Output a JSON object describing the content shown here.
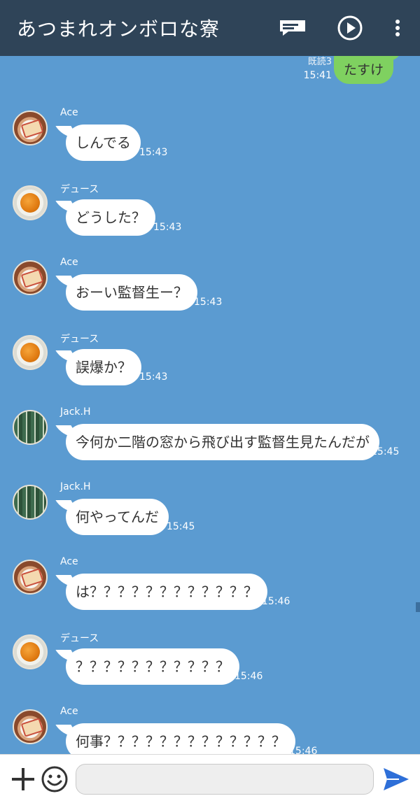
{
  "header": {
    "title": "あつまれオンボロな寮",
    "icons": [
      "notes-icon",
      "play-icon",
      "more-vertical-icon"
    ]
  },
  "sent_message": {
    "text": "たすけ",
    "read_label": "既読3",
    "time": "15:41"
  },
  "messages": [
    {
      "sender": "Ace",
      "avatar": "ace",
      "text": "しんでる",
      "time": "15:43"
    },
    {
      "sender": "デュース",
      "avatar": "deuce",
      "text": "どうした？",
      "time": "15:43"
    },
    {
      "sender": "Ace",
      "avatar": "ace",
      "text": "おーい監督生ー？",
      "time": "15:43"
    },
    {
      "sender": "デュース",
      "avatar": "deuce",
      "text": "誤爆か？",
      "time": "15:43"
    },
    {
      "sender": "Jack.H",
      "avatar": "jack",
      "text": "今何か二階の窓から飛び出す監督生見たんだが",
      "time": "15:45"
    },
    {
      "sender": "Jack.H",
      "avatar": "jack",
      "text": "何やってんだ",
      "time": "15:45"
    },
    {
      "sender": "Ace",
      "avatar": "ace",
      "text": "は？？？？？？？？？？？？",
      "time": "15:46"
    },
    {
      "sender": "デュース",
      "avatar": "deuce",
      "text": "？？？？？？？？？？？",
      "time": "15:46"
    },
    {
      "sender": "Ace",
      "avatar": "ace",
      "text": "何事？？？？？？？？？？？？？",
      "time": "15:46"
    }
  ],
  "input_bar": {
    "placeholder": "",
    "icons": [
      "plus-icon",
      "emoji-icon",
      "send-icon"
    ]
  },
  "colors": {
    "header_bg": "#2f4458",
    "chat_bg": "#5b9bd1",
    "sent_bubble": "#7fd160",
    "received_bubble": "#ffffff",
    "send_icon": "#2e6fd8"
  }
}
